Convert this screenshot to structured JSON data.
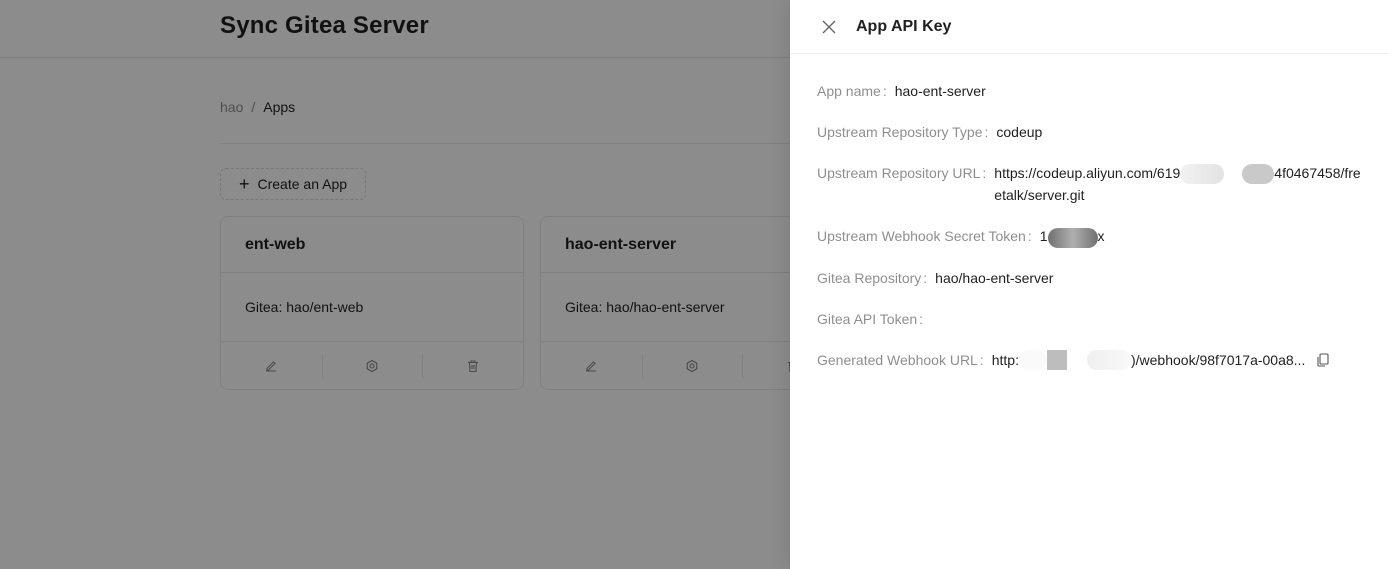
{
  "app": {
    "title": "Sync Gitea Server"
  },
  "breadcrumb": {
    "root": "hao",
    "separator": "/",
    "current": "Apps"
  },
  "toolbar": {
    "create_label": "Create an App"
  },
  "cards": [
    {
      "name": "ent-web",
      "repo": "Gitea: hao/ent-web"
    },
    {
      "name": "hao-ent-server",
      "repo": "Gitea: hao/hao-ent-server"
    }
  ],
  "card_actions": [
    "edit-icon",
    "settings-icon",
    "delete-icon"
  ],
  "drawer": {
    "title": "App API Key",
    "fields": {
      "app_name": {
        "label": "App name",
        "value": "hao-ent-server"
      },
      "upstream_type": {
        "label": "Upstream Repository Type",
        "value": "codeup"
      },
      "upstream_url": {
        "label": "Upstream Repository URL",
        "value_start": "https://codeup.aliyun.com/619",
        "value_end": "4f0467458/freetalk/server.git"
      },
      "secret_token": {
        "label": "Upstream Webhook Secret Token",
        "value_start": "1",
        "value_end": "x"
      },
      "gitea_repo": {
        "label": "Gitea Repository",
        "value": "hao/hao-ent-server"
      },
      "gitea_token": {
        "label": "Gitea API Token",
        "value": ""
      },
      "webhook_url": {
        "label": "Generated Webhook URL",
        "value_start": "http:",
        "value_end": ")/webhook/98f7017a-00a8..."
      }
    }
  },
  "colors": {
    "mask": "#000000",
    "label": "#8c8c8c",
    "text": "#1f1f1f"
  }
}
